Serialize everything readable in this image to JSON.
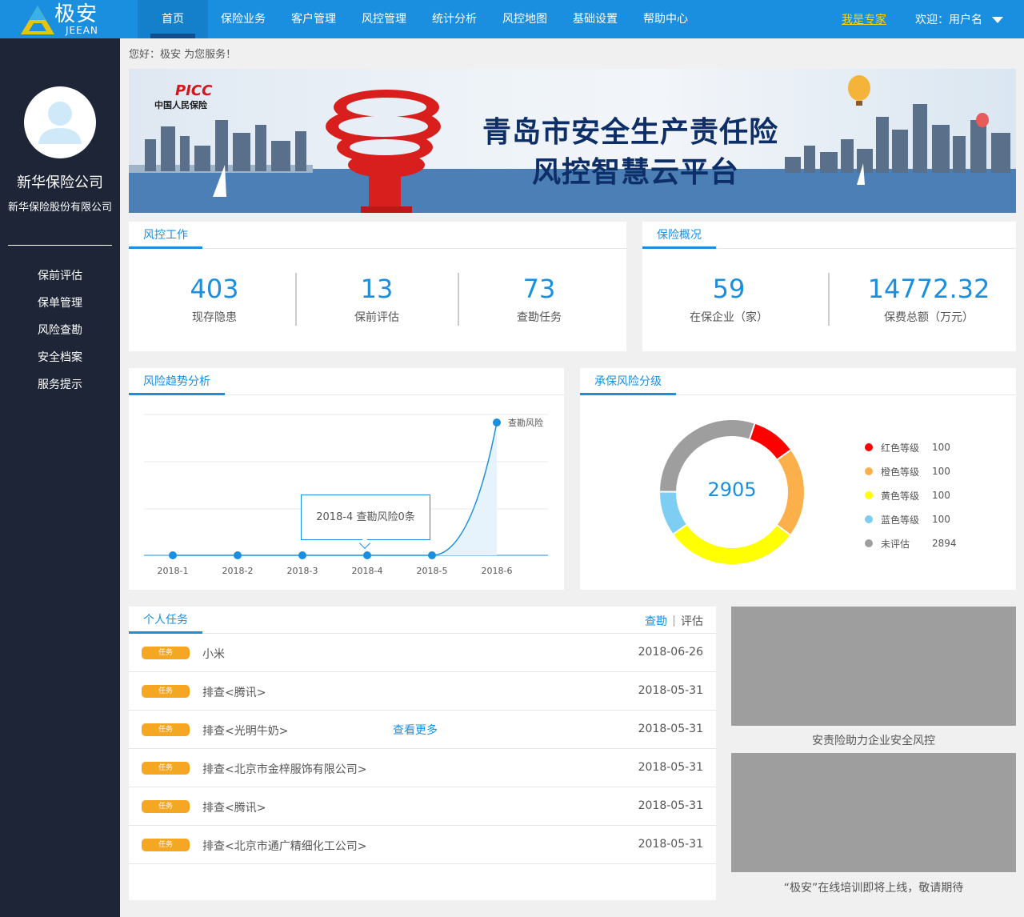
{
  "app": {
    "logo_cn": "极安",
    "logo_en": "JEEAN",
    "expert_link": "我是专家",
    "welcome": "欢迎：用户名"
  },
  "nav": {
    "items": [
      {
        "label": "首页",
        "active": true
      },
      {
        "label": "保险业务"
      },
      {
        "label": "客户管理"
      },
      {
        "label": "风控管理"
      },
      {
        "label": "统计分析"
      },
      {
        "label": "风控地图"
      },
      {
        "label": "基础设置"
      },
      {
        "label": "帮助中心"
      }
    ]
  },
  "sidebar": {
    "company": "新华保险公司",
    "company_full": "新华保险股份有限公司",
    "menu": [
      {
        "label": "保前评估"
      },
      {
        "label": "保单管理"
      },
      {
        "label": "风险查勘"
      },
      {
        "label": "安全档案"
      },
      {
        "label": "服务提示"
      }
    ]
  },
  "greeting": "您好：极安 为您服务！",
  "banner": {
    "logo": "PICC",
    "logo_sub": "中国人民保险",
    "title1": "青岛市安全生产责任险",
    "title2": "风控智慧云平台"
  },
  "risk_work": {
    "title": "风控工作",
    "stats": [
      {
        "value": "403",
        "label": "现存隐患"
      },
      {
        "value": "13",
        "label": "保前评估"
      },
      {
        "value": "73",
        "label": "查勘任务"
      }
    ]
  },
  "insurance_overview": {
    "title": "保险概况",
    "stats": [
      {
        "value": "59",
        "label": "在保企业（家）"
      },
      {
        "value": "14772.32",
        "label": "保费总额（万元）"
      }
    ]
  },
  "trend": {
    "title": "风险趋势分析",
    "tooltip": "2018-4 查勘风险0条"
  },
  "risk_level": {
    "title": "承保风险分级",
    "total": "2905"
  },
  "tasks": {
    "title": "个人任务",
    "tab_survey": "查勘",
    "tab_eval": "评估",
    "more": "查看更多",
    "badge": "任务",
    "rows": [
      {
        "name": "小米",
        "date": "2018-06-26"
      },
      {
        "name": "排查<腾讯>",
        "date": "2018-05-31"
      },
      {
        "name": "排查<光明牛奶>",
        "date": "2018-05-31"
      },
      {
        "name": "排查<北京市金梓服饰有限公司>",
        "date": "2018-05-31"
      },
      {
        "name": "排查<腾讯>",
        "date": "2018-05-31"
      },
      {
        "name": "排查<北京市通广精细化工公司>",
        "date": "2018-05-31"
      }
    ]
  },
  "promos": [
    {
      "caption": "安责险助力企业安全风控"
    },
    {
      "caption": "“极安”在线培训即将上线，敬请期待"
    }
  ],
  "colors": {
    "primary": "#1a8fe0",
    "sidebar": "#1e2536",
    "badge": "#f5a623"
  },
  "chart_data": [
    {
      "type": "area",
      "categories": [
        "2018-1",
        "2018-2",
        "2018-3",
        "2018-4",
        "2018-5",
        "2018-6"
      ],
      "series": [
        {
          "name": "查勘风险",
          "values": [
            0,
            0,
            0,
            0,
            0,
            3
          ]
        }
      ],
      "ylim": [
        0,
        3
      ],
      "grid": true,
      "legend": "label-at-end"
    },
    {
      "type": "pie",
      "donut": true,
      "labels": [
        "红色等级",
        "橙色等级",
        "黄色等级",
        "蓝色等级",
        "未评估"
      ],
      "values": [
        100,
        100,
        100,
        100,
        2894
      ],
      "display_values": [
        100,
        100,
        100,
        100,
        2894
      ],
      "colors": [
        "#ff0000",
        "#fbb04c",
        "#ffff00",
        "#7ecef4",
        "#9e9e9e"
      ],
      "arc_fractions": [
        0.1,
        0.2,
        0.3,
        0.1,
        0.3
      ],
      "center_text": "2905",
      "legend": "right"
    }
  ]
}
